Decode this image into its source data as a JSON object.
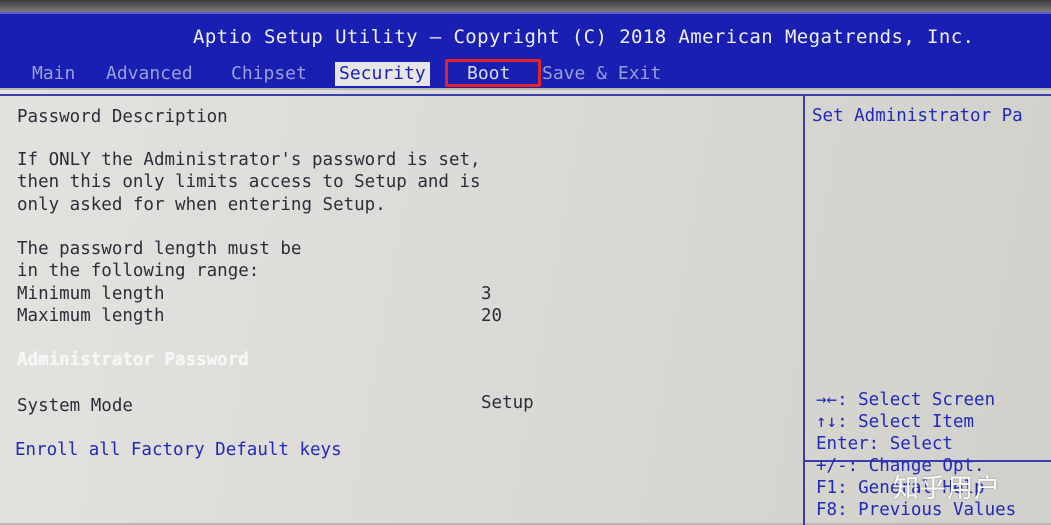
{
  "header": {
    "title": "Aptio Setup Utility – Copyright (C) 2018 American Megatrends, Inc."
  },
  "tabs": [
    {
      "label": "Main"
    },
    {
      "label": "Advanced"
    },
    {
      "label": "Chipset"
    },
    {
      "label": "Security"
    },
    {
      "label": "Boot"
    },
    {
      "label": "Save & Exit"
    }
  ],
  "active_tab": "Security",
  "highlighted_tab": "Boot",
  "colors": {
    "header_bg": "#1a1fb4",
    "highlight_box": "#e52323",
    "text": "#2d2d3a",
    "link_blue": "#1f2bb8"
  },
  "main": {
    "section_title": "Password Description",
    "desc_lines": [
      "If ONLY the Administrator's password is set,",
      "then this only limits access to Setup and is",
      "only asked for when entering Setup."
    ],
    "range_lines": [
      "The password length must be",
      "in the following range:"
    ],
    "min_label": "Minimum length",
    "min_value": "3",
    "max_label": "Maximum length",
    "max_value": "20",
    "admin_password_label": "Administrator Password",
    "system_mode_label": "System Mode",
    "system_mode_value": "Setup",
    "enroll_keys_label": "Enroll all Factory Default keys"
  },
  "help": {
    "description": "Set Administrator Pa",
    "keys": [
      "→←: Select Screen",
      "↑↓: Select Item",
      "Enter: Select",
      "+/-: Change Opt.",
      "F1: General Help",
      "F8: Previous Values"
    ]
  },
  "watermark": "知乎用户"
}
